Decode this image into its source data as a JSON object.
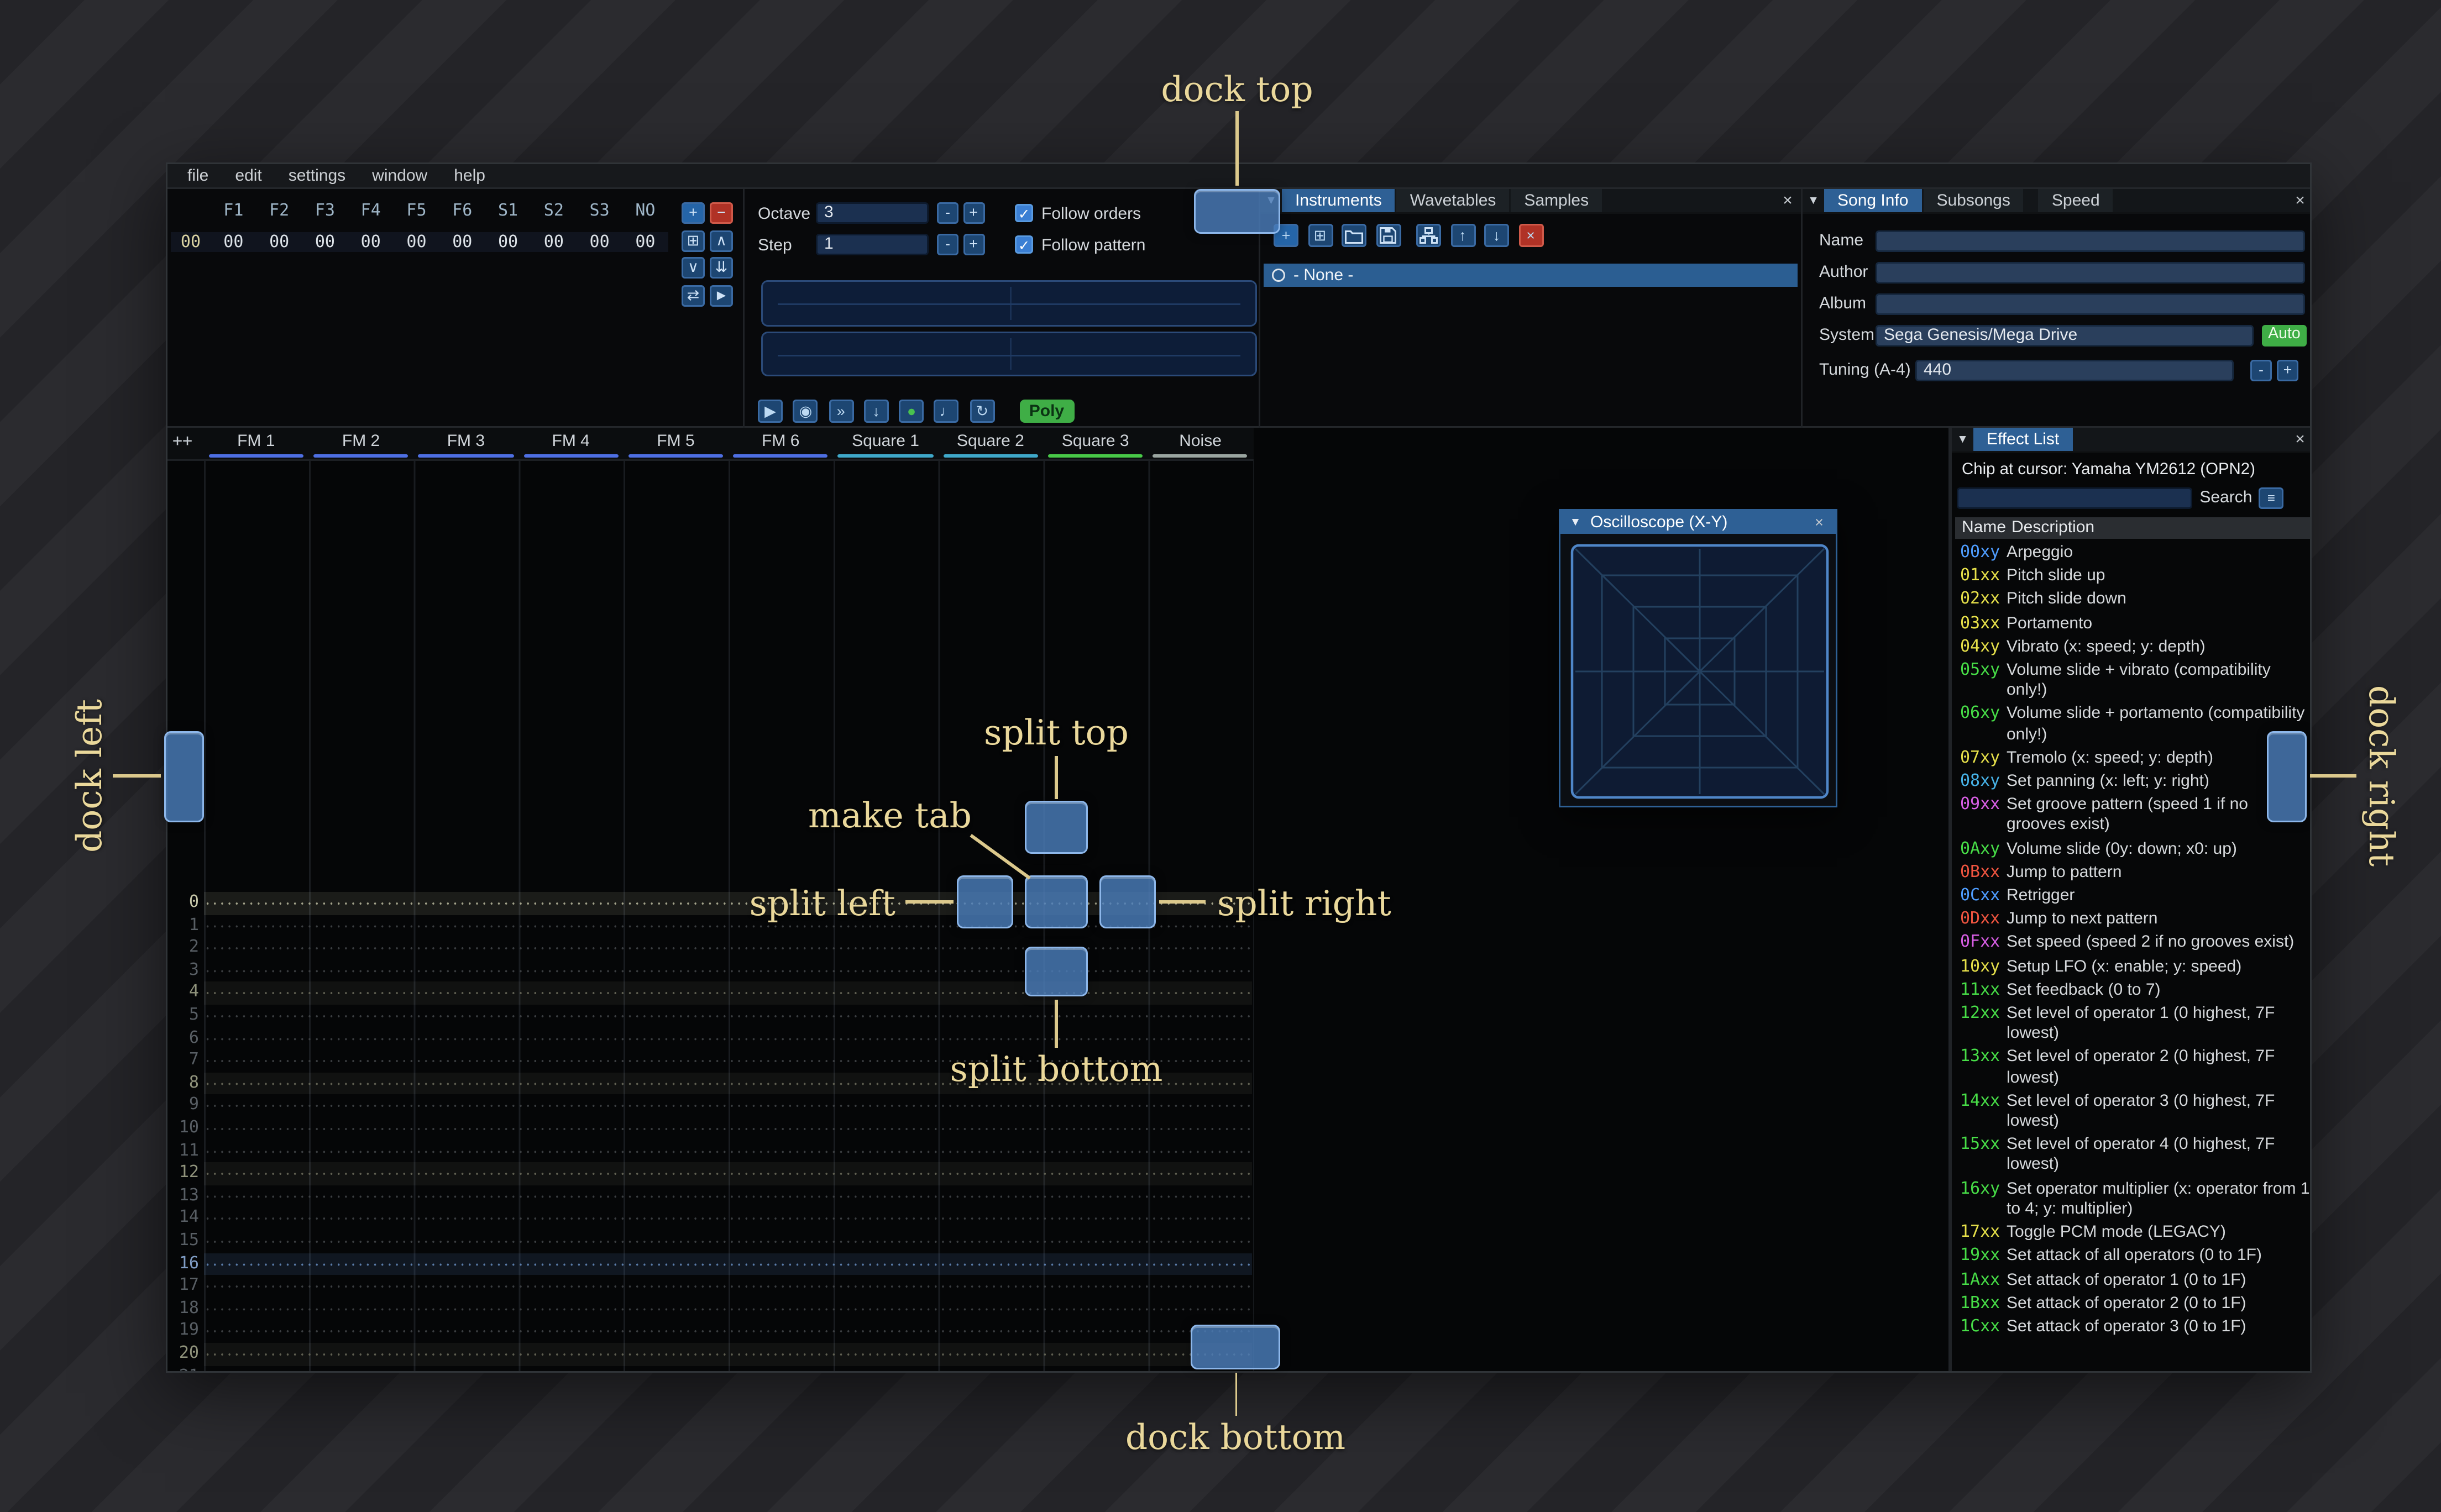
{
  "ui": {
    "minus": "-",
    "plus": "+",
    "check": "✓",
    "collapse": "▼",
    "close": "×",
    "menu": "≡"
  },
  "app": {
    "menu": [
      "file",
      "edit",
      "settings",
      "window",
      "help"
    ]
  },
  "orders": {
    "headers": [
      "F1",
      "F2",
      "F3",
      "F4",
      "F5",
      "F6",
      "S1",
      "S2",
      "S3",
      "NO"
    ],
    "rows": [
      {
        "index": "00",
        "values": [
          "00",
          "00",
          "00",
          "00",
          "00",
          "00",
          "00",
          "00",
          "00",
          "00"
        ]
      }
    ],
    "buttons": [
      {
        "name": "add-order",
        "glyph": "+",
        "style": "add"
      },
      {
        "name": "remove-order",
        "glyph": "−",
        "style": "danger"
      },
      {
        "name": "duplicate-order",
        "glyph": "⊞"
      },
      {
        "name": "move-order-up",
        "glyph": "∧"
      },
      {
        "name": "move-order-down",
        "glyph": "∨"
      },
      {
        "name": "deep-clone-order",
        "glyph": "⇊"
      },
      {
        "name": "order-change-all",
        "glyph": "⇄"
      },
      {
        "name": "order-edit-mode",
        "glyph": "►"
      }
    ]
  },
  "play_controls": {
    "octave_label": "Octave",
    "octave_value": "3",
    "step_label": "Step",
    "step_value": "1",
    "follow_orders_label": "Follow orders",
    "follow_pattern_label": "Follow pattern",
    "poly_label": "Poly",
    "transport": [
      {
        "name": "play",
        "glyph": "▶"
      },
      {
        "name": "play-pattern",
        "glyph": "◉"
      },
      {
        "name": "play-one-row",
        "glyph": "»"
      },
      {
        "name": "step-row",
        "glyph": "↓"
      },
      {
        "name": "edit-toggle",
        "glyph": "●",
        "color": "#49c24f"
      },
      {
        "name": "metronome",
        "glyph": "♩"
      },
      {
        "name": "repeat-pattern",
        "glyph": "↻"
      }
    ]
  },
  "instruments": {
    "tabs": [
      "Instruments",
      "Wavetables",
      "Samples"
    ],
    "active_tab": "Instruments",
    "toolbar": [
      {
        "name": "add-instrument",
        "glyph": "+",
        "style": "add"
      },
      {
        "name": "duplicate-instrument",
        "glyph": "⊞"
      },
      {
        "name": "open-instrument",
        "glyph": "svg-folder"
      },
      {
        "name": "save-instrument",
        "glyph": "svg-floppy"
      },
      {
        "name": "toggle-folders",
        "glyph": "svg-tree"
      },
      {
        "name": "move-instrument-up",
        "glyph": "↑"
      },
      {
        "name": "move-instrument-down",
        "glyph": "↓"
      },
      {
        "name": "delete-instrument",
        "glyph": "×",
        "style": "danger"
      }
    ],
    "list": [
      {
        "label": "- None -",
        "selected": true
      }
    ]
  },
  "song_info": {
    "tabs": [
      "Song Info",
      "Subsongs",
      "Speed"
    ],
    "active_tab": "Song Info",
    "fields": {
      "name": {
        "label": "Name",
        "value": ""
      },
      "author": {
        "label": "Author",
        "value": ""
      },
      "album": {
        "label": "Album",
        "value": ""
      },
      "system": {
        "label": "System",
        "value": "Sega Genesis/Mega Drive",
        "auto_label": "Auto"
      },
      "tuning": {
        "label": "Tuning (A-4)",
        "value": "440"
      }
    }
  },
  "oscilloscope": {
    "title": "Oscilloscope (X-Y)"
  },
  "pattern": {
    "add_button_label": "++",
    "row_count": 22,
    "cursor_row": 0,
    "highlight_every": 4,
    "highlight_major": 16,
    "channels": [
      {
        "name": "FM 1",
        "color": "#4e6fe3"
      },
      {
        "name": "FM 2",
        "color": "#4e6fe3"
      },
      {
        "name": "FM 3",
        "color": "#4e6fe3"
      },
      {
        "name": "FM 4",
        "color": "#4e6fe3"
      },
      {
        "name": "FM 5",
        "color": "#4e6fe3"
      },
      {
        "name": "FM 6",
        "color": "#4e6fe3"
      },
      {
        "name": "Square 1",
        "color": "#3fa8c9"
      },
      {
        "name": "Square 2",
        "color": "#3fa8c9"
      },
      {
        "name": "Square 3",
        "color": "#48c948"
      },
      {
        "name": "Noise",
        "color": "#9aa5a0"
      }
    ]
  },
  "effect_list": {
    "tab_label": "Effect List",
    "chip_label": "Chip at cursor: Yamaha YM2612 (OPN2)",
    "search_label": "Search",
    "columns": [
      "Name",
      "Description"
    ],
    "effects": [
      {
        "code": "00xy",
        "desc": "Arpeggio",
        "color": "#4f9dff"
      },
      {
        "code": "01xx",
        "desc": "Pitch slide up",
        "color": "#e6e04a"
      },
      {
        "code": "02xx",
        "desc": "Pitch slide down",
        "color": "#e6e04a"
      },
      {
        "code": "03xx",
        "desc": "Portamento",
        "color": "#e6e04a"
      },
      {
        "code": "04xy",
        "desc": "Vibrato (x: speed; y: depth)",
        "color": "#e6e04a"
      },
      {
        "code": "05xy",
        "desc": "Volume slide + vibrato (compatibility only!)",
        "color": "#47dd47"
      },
      {
        "code": "06xy",
        "desc": "Volume slide + portamento (compatibility only!)",
        "color": "#47dd47"
      },
      {
        "code": "07xy",
        "desc": "Tremolo (x: speed; y: depth)",
        "color": "#e6e04a"
      },
      {
        "code": "08xy",
        "desc": "Set panning (x: left; y: right)",
        "color": "#47b3e8"
      },
      {
        "code": "09xx",
        "desc": "Set groove pattern (speed 1 if no grooves exist)",
        "color": "#d95fe6"
      },
      {
        "code": "0Axy",
        "desc": "Volume slide (0y: down; x0: up)",
        "color": "#47dd47"
      },
      {
        "code": "0Bxx",
        "desc": "Jump to pattern",
        "color": "#f05540"
      },
      {
        "code": "0Cxx",
        "desc": "Retrigger",
        "color": "#4f9dff"
      },
      {
        "code": "0Dxx",
        "desc": "Jump to next pattern",
        "color": "#f05540"
      },
      {
        "code": "0Fxx",
        "desc": "Set speed (speed 2 if no grooves exist)",
        "color": "#d95fe6"
      },
      {
        "code": "10xy",
        "desc": "Setup LFO (x: enable; y: speed)",
        "color": "#e6e04a"
      },
      {
        "code": "11xx",
        "desc": "Set feedback (0 to 7)",
        "color": "#47dd47"
      },
      {
        "code": "12xx",
        "desc": "Set level of operator 1 (0 highest, 7F lowest)",
        "color": "#47dd47"
      },
      {
        "code": "13xx",
        "desc": "Set level of operator 2 (0 highest, 7F lowest)",
        "color": "#47dd47"
      },
      {
        "code": "14xx",
        "desc": "Set level of operator 3 (0 highest, 7F lowest)",
        "color": "#47dd47"
      },
      {
        "code": "15xx",
        "desc": "Set level of operator 4 (0 highest, 7F lowest)",
        "color": "#47dd47"
      },
      {
        "code": "16xy",
        "desc": "Set operator multiplier (x: operator from 1 to 4; y: multiplier)",
        "color": "#47dd47"
      },
      {
        "code": "17xx",
        "desc": "Toggle PCM mode (LEGACY)",
        "color": "#e6e04a"
      },
      {
        "code": "19xx",
        "desc": "Set attack of all operators (0 to 1F)",
        "color": "#47dd47"
      },
      {
        "code": "1Axx",
        "desc": "Set attack of operator 1 (0 to 1F)",
        "color": "#47dd47"
      },
      {
        "code": "1Bxx",
        "desc": "Set attack of operator 2 (0 to 1F)",
        "color": "#47dd47"
      },
      {
        "code": "1Cxx",
        "desc": "Set attack of operator 3 (0 to 1F)",
        "color": "#47dd47"
      }
    ]
  },
  "overlay": {
    "labels": {
      "dock_top": "dock top",
      "dock_left": "dock left",
      "dock_right": "dock right",
      "dock_bottom": "dock bottom",
      "split_top": "split top",
      "split_left": "split left",
      "split_right": "split right",
      "split_bottom": "split bottom",
      "make_tab": "make tab"
    }
  }
}
